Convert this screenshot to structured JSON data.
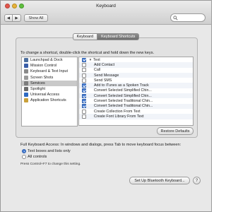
{
  "window": {
    "title": "Keyboard"
  },
  "toolbar": {
    "back": "◀",
    "forward": "▶",
    "show_all": "Show All",
    "search_placeholder": ""
  },
  "tabs": [
    {
      "label": "Keyboard"
    },
    {
      "label": "Keyboard Shortcuts"
    }
  ],
  "instruction": "To change a shortcut, double-click the shortcut and hold down the new keys.",
  "categories": [
    {
      "label": "Launchpad & Dock",
      "icon": "launchpad-icon",
      "color": "#4d6f9e"
    },
    {
      "label": "Mission Control",
      "icon": "mission-control-icon",
      "color": "#3a5ea8"
    },
    {
      "label": "Keyboard & Text Input",
      "icon": "keyboard-icon",
      "color": "#8a8a8a"
    },
    {
      "label": "Screen Shots",
      "icon": "camera-icon",
      "color": "#9a9a9a"
    },
    {
      "label": "Services",
      "icon": "services-icon",
      "color": "#7d7d7d"
    },
    {
      "label": "Spotlight",
      "icon": "spotlight-icon",
      "color": "#6b6b6b"
    },
    {
      "label": "Universal Access",
      "icon": "universal-access-icon",
      "color": "#2f6ac2"
    },
    {
      "label": "Application Shortcuts",
      "icon": "app-shortcuts-icon",
      "color": "#c9a03a"
    }
  ],
  "selected_category": "Services",
  "shortcuts": [
    {
      "label": "Text",
      "checked": true,
      "group": true
    },
    {
      "label": "Add Contact",
      "checked": false
    },
    {
      "label": "Call",
      "checked": false
    },
    {
      "label": "Send Message",
      "checked": false
    },
    {
      "label": "Send SMS",
      "checked": false
    },
    {
      "label": "Add to iTunes as a Spoken Track",
      "checked": true
    },
    {
      "label": "Convert Selected Simplified Chin...",
      "checked": true
    },
    {
      "label": "Convert Selected Simplified Chin...",
      "checked": true
    },
    {
      "label": "Convert Selected Traditional Chin...",
      "checked": true
    },
    {
      "label": "Convert Selected Traditional Chin...",
      "checked": true
    },
    {
      "label": "Create Collection From Text",
      "checked": false
    },
    {
      "label": "Create Font Library From Text",
      "checked": false
    }
  ],
  "restore_defaults": "Restore Defaults",
  "full_keyboard_access": {
    "text": "Full Keyboard Access: In windows and dialogs, press Tab to move keyboard focus between:",
    "options": [
      {
        "label": "Text boxes and lists only",
        "selected": true
      },
      {
        "label": "All controls",
        "selected": false
      }
    ],
    "hint": "Press Control+F7 to change this setting."
  },
  "bluetooth_button": "Set Up Bluetooth Keyboard...",
  "help_button": "?"
}
